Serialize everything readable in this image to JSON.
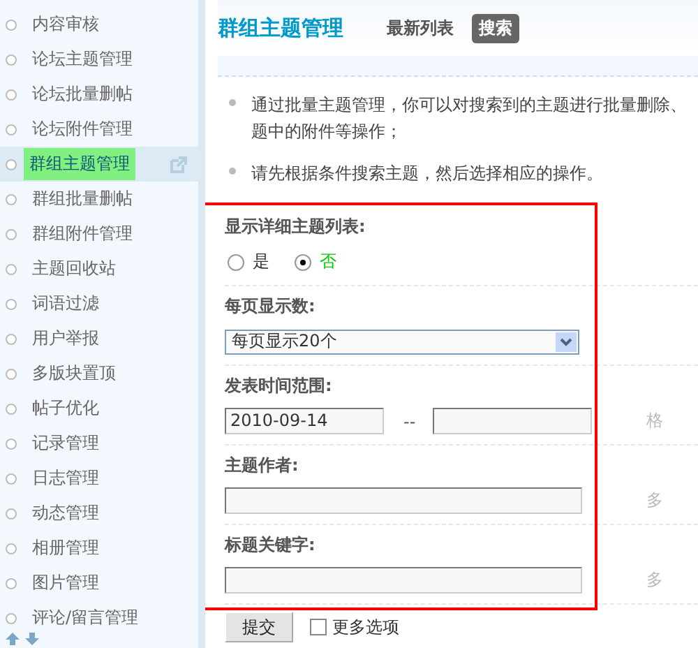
{
  "sidebar": {
    "items": [
      {
        "label": "内容审核",
        "selected": false
      },
      {
        "label": "论坛主题管理",
        "selected": false
      },
      {
        "label": "论坛批量删帖",
        "selected": false
      },
      {
        "label": "论坛附件管理",
        "selected": false
      },
      {
        "label": "群组主题管理",
        "selected": true
      },
      {
        "label": "群组批量删帖",
        "selected": false
      },
      {
        "label": "群组附件管理",
        "selected": false
      },
      {
        "label": "主题回收站",
        "selected": false
      },
      {
        "label": "词语过滤",
        "selected": false
      },
      {
        "label": "用户举报",
        "selected": false
      },
      {
        "label": "多版块置顶",
        "selected": false
      },
      {
        "label": "帖子优化",
        "selected": false
      },
      {
        "label": "记录管理",
        "selected": false
      },
      {
        "label": "日志管理",
        "selected": false
      },
      {
        "label": "动态管理",
        "selected": false
      },
      {
        "label": "相册管理",
        "selected": false
      },
      {
        "label": "图片管理",
        "selected": false
      },
      {
        "label": "评论/留言管理",
        "selected": false
      }
    ]
  },
  "header": {
    "title": "群组主题管理",
    "tabs": [
      {
        "label": "最新列表",
        "selected": false
      },
      {
        "label": "搜索",
        "selected": true
      }
    ]
  },
  "tips": [
    {
      "lines": [
        "通过批量主题管理，你可以对搜索到的主题进行批量删除、",
        "题中的附件等操作；"
      ]
    },
    {
      "lines": [
        "请先根据条件搜索主题，然后选择相应的操作。"
      ]
    }
  ],
  "form": {
    "rows": [
      {
        "kind": "radio",
        "label": "显示详细主题列表:",
        "options": [
          {
            "label": "是",
            "selected": false
          },
          {
            "label": "否",
            "selected": true
          }
        ]
      },
      {
        "kind": "select",
        "label": "每页显示数:",
        "value": "每页显示20个"
      },
      {
        "kind": "range",
        "label": "发表时间范围:",
        "value": "2010-09-14",
        "separator": "--",
        "hint": "格"
      },
      {
        "kind": "text",
        "label": "主题作者:",
        "hint": "多"
      },
      {
        "kind": "text",
        "label": "标题关键字:",
        "hint": "多"
      }
    ],
    "submit": "提交",
    "more_options": {
      "label": "更多选项",
      "checked": false
    }
  }
}
